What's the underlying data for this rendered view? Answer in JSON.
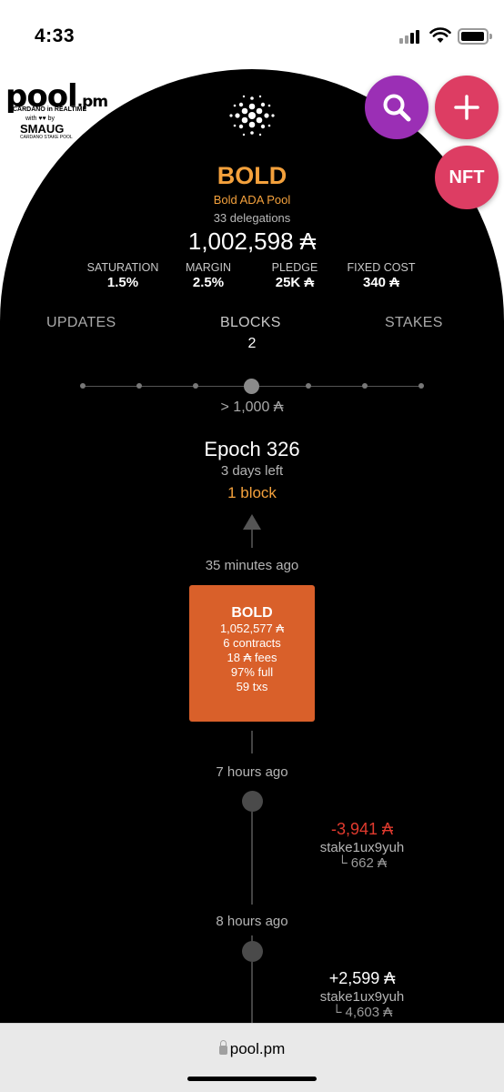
{
  "status_bar": {
    "time": "4:33"
  },
  "logo": {
    "word": "pool",
    "word_suffix": ".pm",
    "subtitle": "CARDANO in REALTIME",
    "with_by": "with ♥♥ by",
    "partner": "SMAUG",
    "partner_sub": "CARDANO STAKE POOL"
  },
  "fabs": {
    "search_icon": "search-icon",
    "add_label": "+",
    "nft_label": "NFT"
  },
  "pool": {
    "ticker": "BOLD",
    "name": "Bold ADA Pool",
    "delegations": "33 delegations",
    "stake": "1,002,598 ₳"
  },
  "stats": [
    {
      "label": "SATURATION",
      "value": "1.5%"
    },
    {
      "label": "MARGIN",
      "value": "2.5%"
    },
    {
      "label": "PLEDGE",
      "value": "25K ₳"
    },
    {
      "label": "FIXED COST",
      "value": "340 ₳"
    }
  ],
  "tabs": {
    "updates": "UPDATES",
    "blocks": "BLOCKS",
    "blocks_count": "2",
    "stakes": "STAKES"
  },
  "filter": {
    "threshold": "> 1,000 ₳"
  },
  "epoch": {
    "title": "Epoch 326",
    "time_left": "3 days left",
    "blocks": "1 block"
  },
  "timeline": {
    "time_1": "35 minutes ago",
    "block": {
      "ticker": "BOLD",
      "size": "1,052,577 ₳",
      "contracts": "6 contracts",
      "fees": "18 ₳ fees",
      "full": "97% full",
      "txs": "59 txs"
    },
    "time_2": "7 hours ago",
    "event_1": {
      "amount": "-3,941 ₳",
      "address": "stake1ux9yuh",
      "balance": "└ 662 ₳"
    },
    "time_3": "8 hours ago",
    "event_2": {
      "amount": "+2,599 ₳",
      "address": "stake1ux9yuh",
      "balance": "└ 4,603 ₳"
    }
  },
  "colors": {
    "accent": "#f4a13c",
    "block": "#d9602a",
    "negative": "#e03a2e",
    "purple": "#9b2fb5",
    "pink": "#dd3d63"
  },
  "browser": {
    "url": "pool.pm"
  }
}
